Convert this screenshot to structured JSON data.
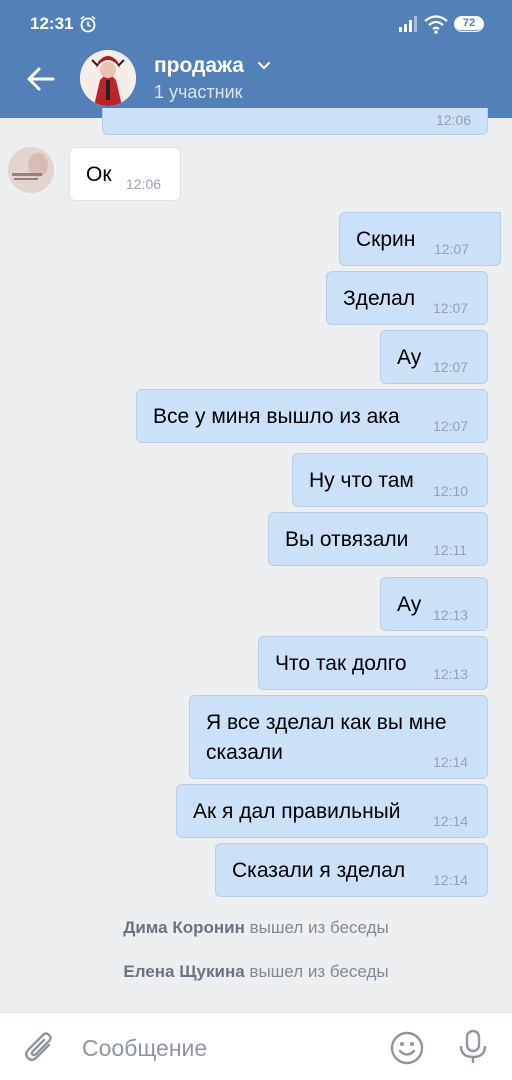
{
  "status": {
    "time": "12:31",
    "battery": "72"
  },
  "header": {
    "title": "продажа",
    "subtitle": "1 участник"
  },
  "messages": [
    {
      "text": "Ок",
      "time": "12:06"
    },
    {
      "text": "Скрин",
      "time": "12:07"
    },
    {
      "text": "Зделал",
      "time": "12:07"
    },
    {
      "text": "Ау",
      "time": "12:07"
    },
    {
      "text": "Все у миня вышло из ака",
      "time": "12:07"
    },
    {
      "text": "Ну что там",
      "time": "12:10"
    },
    {
      "text": "Вы отвязали",
      "time": "12:11"
    },
    {
      "text": "Ау",
      "time": "12:13"
    },
    {
      "text": "Что так долго",
      "time": "12:13"
    },
    {
      "text_line1": "Я все зделал как вы мне",
      "text_line2": "сказали",
      "time": "12:14"
    },
    {
      "text": "Ак я дал правильный",
      "time": "12:14"
    },
    {
      "text": "Сказали я зделал",
      "time": "12:14"
    }
  ],
  "partial_message": {
    "time": "12:06"
  },
  "system": [
    {
      "name": "Дима Коронин",
      "action": "вышел из беседы"
    },
    {
      "name": "Елена Щукина",
      "action": "вышел из беседы"
    }
  ],
  "composer": {
    "placeholder": "Сообщение"
  }
}
